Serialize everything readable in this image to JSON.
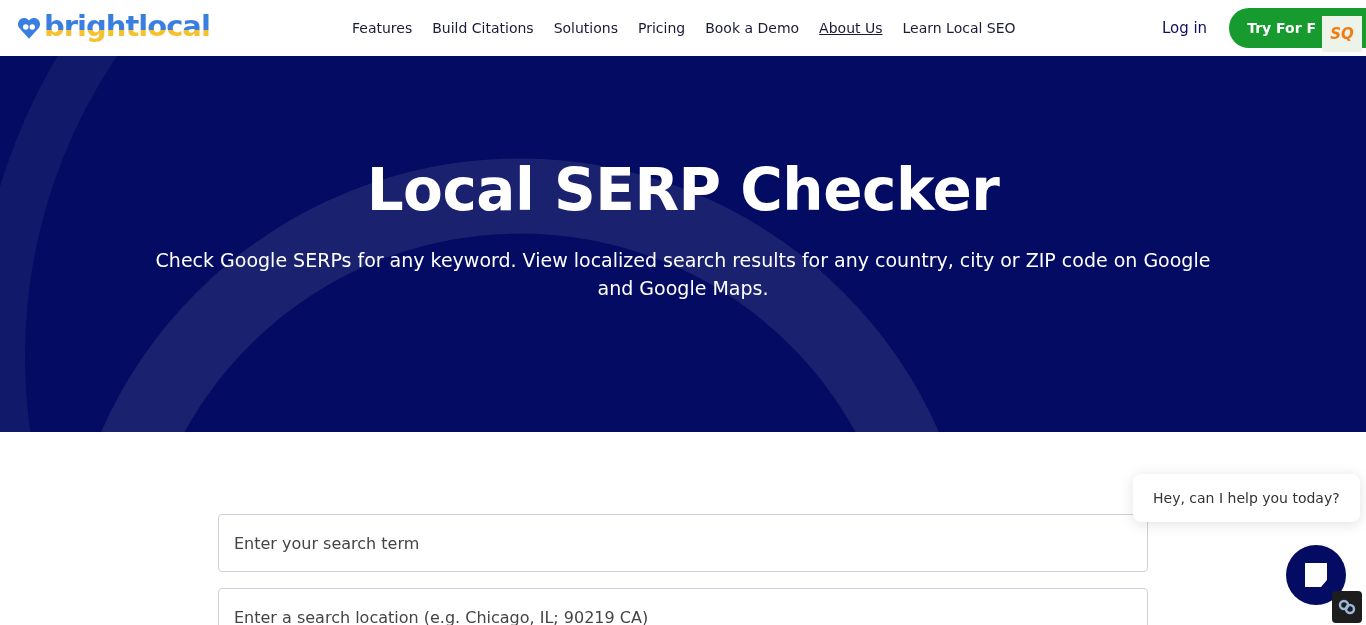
{
  "header": {
    "logo": "brightlocal",
    "nav": [
      {
        "label": "Features",
        "selected": false
      },
      {
        "label": "Build Citations",
        "selected": false
      },
      {
        "label": "Solutions",
        "selected": false
      },
      {
        "label": "Pricing",
        "selected": false
      },
      {
        "label": "Book a Demo",
        "selected": false
      },
      {
        "label": "About Us",
        "selected": true
      },
      {
        "label": "Learn Local SEO",
        "selected": false
      }
    ],
    "login": "Log in",
    "cta": "Try For F",
    "badge": "SQ"
  },
  "hero": {
    "title": "Local SERP Checker",
    "subtitle": "Check Google SERPs for any keyword. View localized search results for any country, city or ZIP code on Google and Google Maps."
  },
  "form": {
    "fields": [
      {
        "placeholder": "Enter your search term"
      },
      {
        "placeholder": "Enter a search location (e.g. Chicago, IL; 90219 CA)"
      }
    ]
  },
  "chat": {
    "message": "Hey, can I help you today?"
  }
}
